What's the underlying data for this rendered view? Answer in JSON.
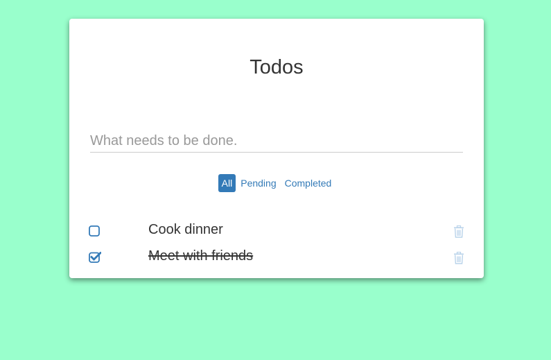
{
  "app": {
    "title": "Todos"
  },
  "new_todo": {
    "placeholder": "What needs to be done.",
    "value": ""
  },
  "filters": [
    {
      "label": "All",
      "active": true
    },
    {
      "label": "Pending",
      "active": false
    },
    {
      "label": "Completed",
      "active": false
    }
  ],
  "todos": [
    {
      "text": "Cook dinner",
      "completed": false
    },
    {
      "text": "Meet with friends",
      "completed": true
    }
  ],
  "icons": {
    "checkbox_unchecked": "square-icon",
    "checkbox_checked": "check-square-icon",
    "delete": "trash-icon"
  },
  "colors": {
    "background": "#99ffcc",
    "accent": "#337ab7",
    "trash": "#b9d3ea",
    "text": "#333333"
  }
}
